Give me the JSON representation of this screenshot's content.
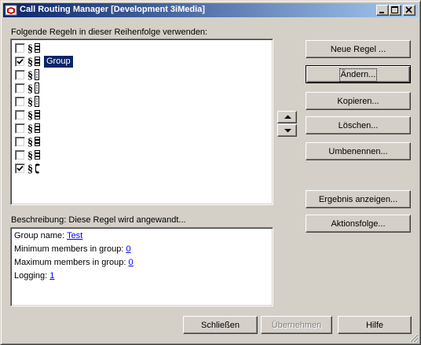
{
  "window": {
    "title": "Call Routing Manager [Development 3iMedia]",
    "buttons": {
      "minimize": "_",
      "maximize": "□",
      "close": "×"
    }
  },
  "rules_label": "Folgende Regeln in dieser Reihenfolge verwenden:",
  "rules": [
    {
      "checked": false,
      "icon": "rule-stack-icon",
      "name": ""
    },
    {
      "checked": true,
      "icon": "rule-stack-icon",
      "name": "Group",
      "selected": true
    },
    {
      "checked": false,
      "icon": "rule-list-icon",
      "name": ""
    },
    {
      "checked": false,
      "icon": "rule-list-icon",
      "name": ""
    },
    {
      "checked": false,
      "icon": "rule-list-icon",
      "name": ""
    },
    {
      "checked": false,
      "icon": "rule-stack-icon",
      "name": ""
    },
    {
      "checked": false,
      "icon": "rule-stack-icon",
      "name": ""
    },
    {
      "checked": false,
      "icon": "rule-stack-icon",
      "name": ""
    },
    {
      "checked": false,
      "icon": "rule-stack-icon",
      "name": ""
    },
    {
      "checked": true,
      "icon": "rule-phone-icon",
      "name": ""
    }
  ],
  "actions": {
    "new_rule": "Neue Regel ...",
    "edit": "Ändern...",
    "copy": "Kopieren...",
    "delete": "Löschen...",
    "rename": "Umbenennen...",
    "show_result": "Ergebnis anzeigen...",
    "action_sequence": "Aktionsfolge..."
  },
  "description": {
    "label": "Beschreibung: Diese Regel wird angewandt...",
    "lines": [
      {
        "text": "Group name: ",
        "link": "Test"
      },
      {
        "text": "Minimum members in group: ",
        "link": "0"
      },
      {
        "text": "Maximum members in group: ",
        "link": "0"
      },
      {
        "text": "Logging: ",
        "link": "1"
      }
    ]
  },
  "footer": {
    "close": "Schließen",
    "apply": "Übernehmen",
    "help": "Hilfe"
  },
  "colors": {
    "face": "#d4d0c8",
    "title_start": "#0a246a",
    "title_end": "#a6caf0",
    "selection": "#0a246a",
    "link": "#0000ff"
  }
}
